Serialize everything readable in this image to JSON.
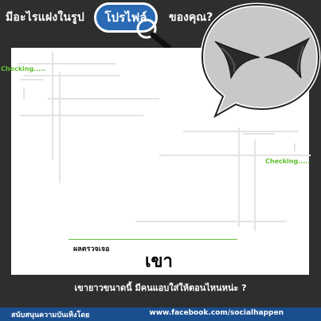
{
  "header": {
    "title_left": "มีอะไรแฝงในรูป",
    "title_badge": "โปรไฟล์",
    "title_right": "ของคุณ?"
  },
  "scan": {
    "checking_left": "Checking.....",
    "checking_right": "Checking....."
  },
  "result": {
    "label": "ผลตรวจเจอ",
    "value": "เขา"
  },
  "caption": "เขายาวขนาดนี้ มีคนแอบใส่ให้ตอนไหนหน่ะ ?",
  "footer": {
    "left": "สนับสนุนความบันเทิงโดย",
    "right": "www.facebook.com/socialhappen"
  },
  "colors": {
    "background": "#2e2e2e",
    "badge": "#2a6ab4",
    "checking": "#5fbf2f",
    "footer": "#1a4f8f"
  },
  "icons": [
    "magnifier-icon",
    "speech-bubble-icon",
    "horns-icon"
  ]
}
